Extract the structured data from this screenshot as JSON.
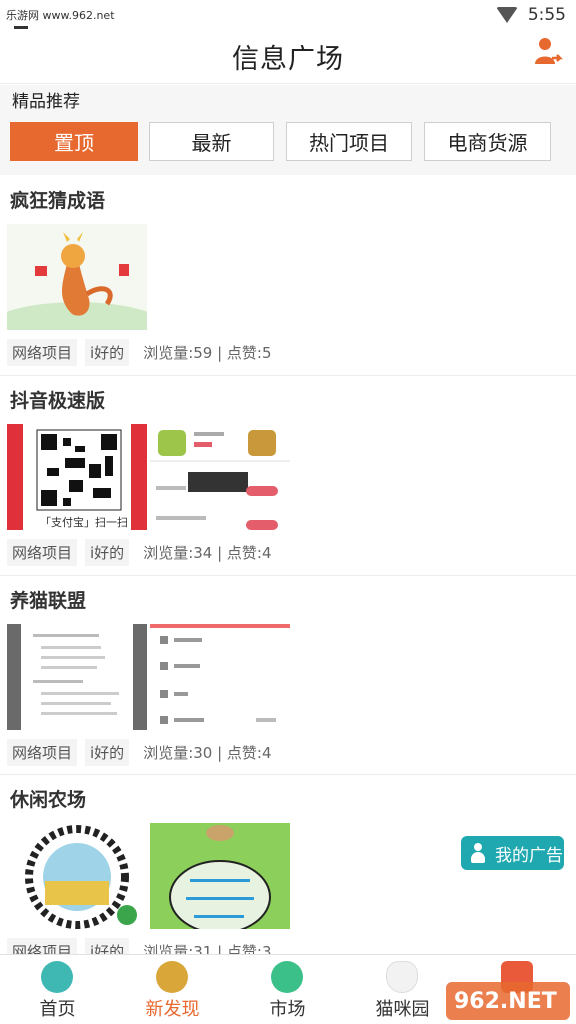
{
  "status_bar": {
    "watermark": "乐游网 www.962.net",
    "time": "5:55"
  },
  "header": {
    "title": "信息广场"
  },
  "section_label": "精品推荐",
  "tabs": [
    {
      "label": "置顶",
      "active": true
    },
    {
      "label": "最新",
      "active": false
    },
    {
      "label": "热门项目",
      "active": false
    },
    {
      "label": "电商货源",
      "active": false
    }
  ],
  "posts": [
    {
      "title": "疯狂猜成语",
      "tags": [
        "网络项目",
        "i好的"
      ],
      "stats": "浏览量:59 | 点赞:5"
    },
    {
      "title": "抖音极速版",
      "tags": [
        "网络项目",
        "i好的"
      ],
      "stats": "浏览量:34 | 点赞:4",
      "thumb_caption": "「支付宝」扫一扫"
    },
    {
      "title": "养猫联盟",
      "tags": [
        "网络项目",
        "i好的"
      ],
      "stats": "浏览量:30 | 点赞:4"
    },
    {
      "title": "休闲农场",
      "tags": [
        "网络项目",
        "i好的"
      ],
      "stats": "浏览量:31 | 点赞:3"
    }
  ],
  "ad_button": {
    "label": "我的广告"
  },
  "bottom_nav": [
    {
      "label": "首页",
      "icon": "home-icon",
      "active": false
    },
    {
      "label": "新发现",
      "icon": "coins-icon",
      "active": true
    },
    {
      "label": "市场",
      "icon": "chart-icon",
      "active": false
    },
    {
      "label": "猫咪园",
      "icon": "cat-icon",
      "active": false
    },
    {
      "label": "",
      "icon": "cart-icon",
      "active": false
    }
  ],
  "watermark_bottom": "962.NET 乐游网",
  "colors": {
    "accent": "#e8692f",
    "ad": "#1fa8b0",
    "teal_icon": "#3fb8b4",
    "gold_icon": "#d9a63a",
    "green_icon": "#3cc08a"
  }
}
